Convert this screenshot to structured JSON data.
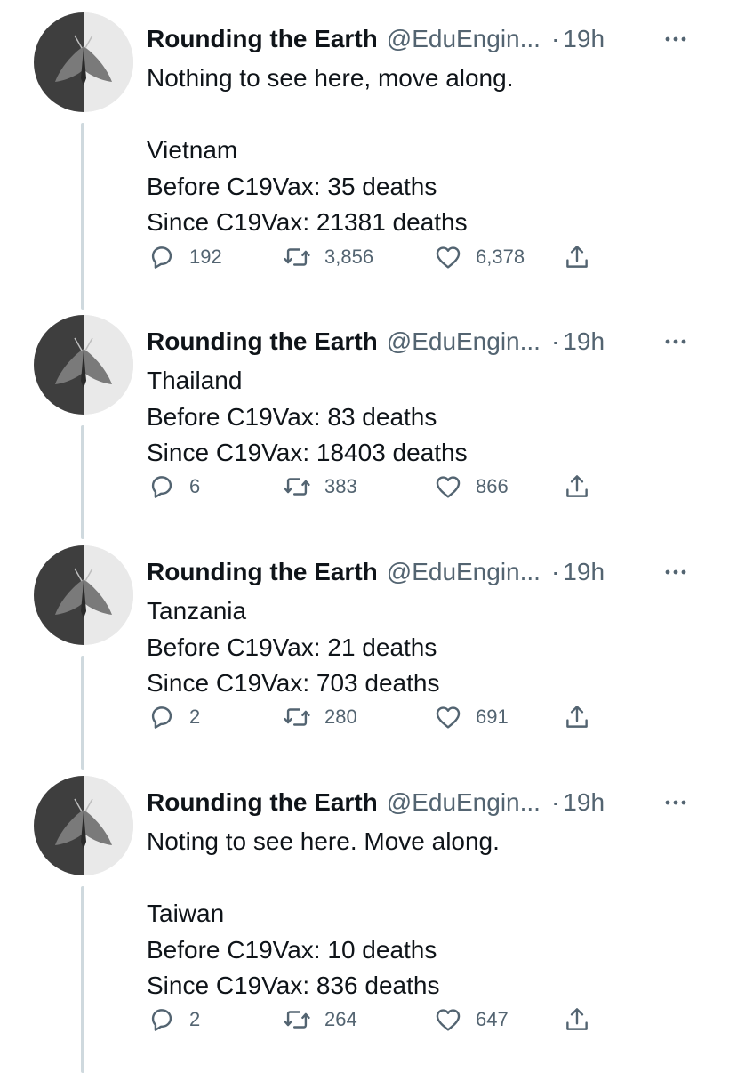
{
  "tweets": [
    {
      "name": "Rounding the Earth",
      "handle": "@EduEngin...",
      "dot": "·",
      "time": "19h",
      "lines": [
        "Nothing to see here, move along.",
        "",
        "Vietnam",
        "Before C19Vax: 35 deaths",
        "Since C19Vax: 21381 deaths"
      ],
      "replies": "192",
      "retweets": "3,856",
      "likes": "6,378"
    },
    {
      "name": "Rounding the Earth",
      "handle": "@EduEngin...",
      "dot": "·",
      "time": "19h",
      "lines": [
        "Thailand",
        "Before C19Vax: 83 deaths",
        "Since C19Vax: 18403 deaths"
      ],
      "replies": "6",
      "retweets": "383",
      "likes": "866"
    },
    {
      "name": "Rounding the Earth",
      "handle": "@EduEngin...",
      "dot": "·",
      "time": "19h",
      "lines": [
        "Tanzania",
        "Before C19Vax: 21 deaths",
        "Since C19Vax: 703 deaths"
      ],
      "replies": "2",
      "retweets": "280",
      "likes": "691"
    },
    {
      "name": "Rounding the Earth",
      "handle": "@EduEngin...",
      "dot": "·",
      "time": "19h",
      "lines": [
        "Noting to see here. Move along.",
        "",
        "Taiwan",
        "Before C19Vax: 10 deaths",
        "Since C19Vax: 836 deaths"
      ],
      "replies": "2",
      "retweets": "264",
      "likes": "647"
    }
  ],
  "icons": {
    "reply": "reply-icon",
    "retweet": "retweet-icon",
    "like": "heart-icon",
    "share": "share-icon",
    "more": "more-icon",
    "avatar": "moth-avatar"
  },
  "colors": {
    "text": "#0f1419",
    "secondary": "#536471",
    "thread_line": "#cfd9de",
    "background": "#ffffff"
  }
}
